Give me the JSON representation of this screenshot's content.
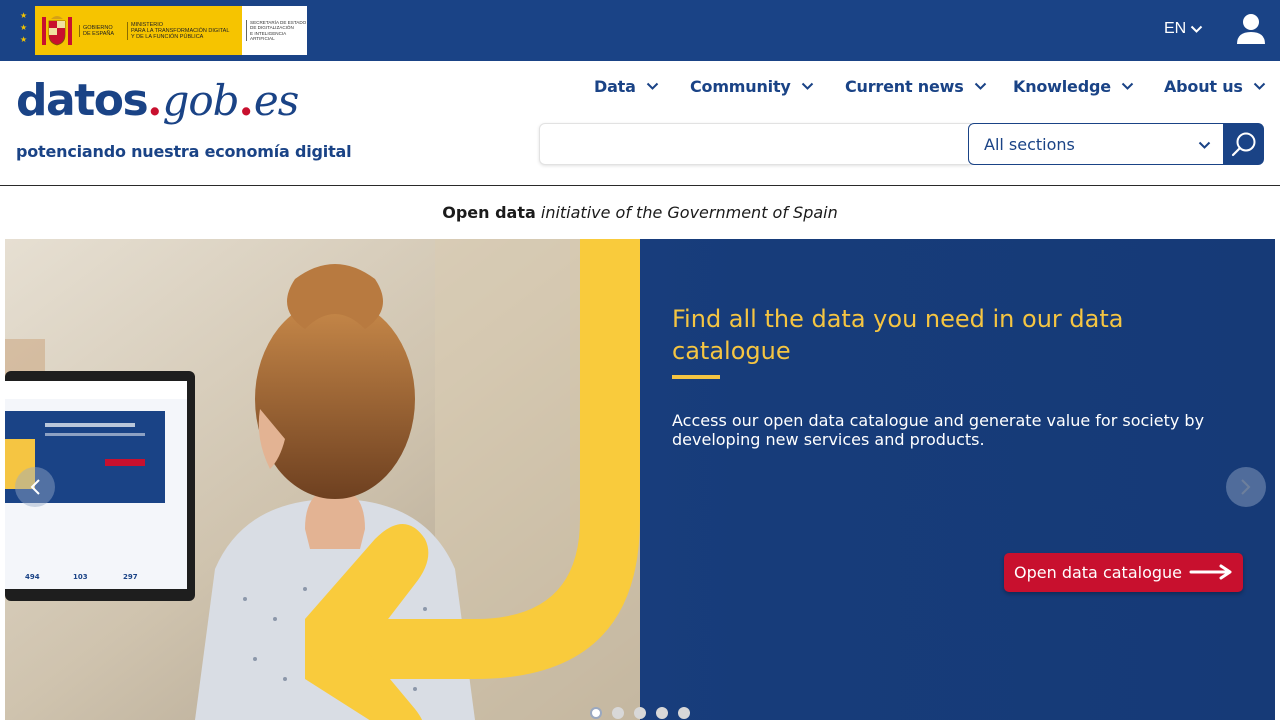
{
  "gov_bar": {
    "logo": {
      "gobierno_line1": "GOBIERNO",
      "gobierno_line2": "DE ESPAÑA",
      "ministerio_line1": "MINISTERIO",
      "ministerio_line2": "PARA LA TRANSFORMACIÓN DIGITAL",
      "ministerio_line3": "Y DE LA FUNCIÓN PÚBLICA",
      "secretaria_line1": "SECRETARÍA DE ESTADO",
      "secretaria_line2": "DE DIGITALIZACIÓN",
      "secretaria_line3": "E INTELIGENCIA ARTIFICIAL"
    },
    "language": "EN",
    "user_icon": "user-icon"
  },
  "header": {
    "brand": {
      "part1": "datos",
      "dot1": ".",
      "part2": "gob",
      "dot2": ".",
      "part3": "es"
    },
    "tagline": "potenciando nuestra economía digital",
    "nav": [
      {
        "label": "Data"
      },
      {
        "label": "Community"
      },
      {
        "label": "Current news"
      },
      {
        "label": "Knowledge"
      },
      {
        "label": "About us"
      }
    ],
    "search": {
      "placeholder": "",
      "value": "",
      "section_selected": "All sections",
      "search_icon": "search-icon"
    }
  },
  "intro": {
    "bold": "Open data",
    "italic": "initiative of the Government of Spain"
  },
  "hero": {
    "title": "Find all the data you need in our data catalogue",
    "description": "Access our open data catalogue and generate value for society by developing new services and products.",
    "cta_label": "Open data catalogue",
    "slides_count": 5,
    "active_slide": 1,
    "colors": {
      "accent": "#f5c542",
      "cta": "#c8102e",
      "background": "#1b4385"
    }
  },
  "colors": {
    "brand_blue": "#1a4386",
    "brand_red": "#c8102e"
  }
}
